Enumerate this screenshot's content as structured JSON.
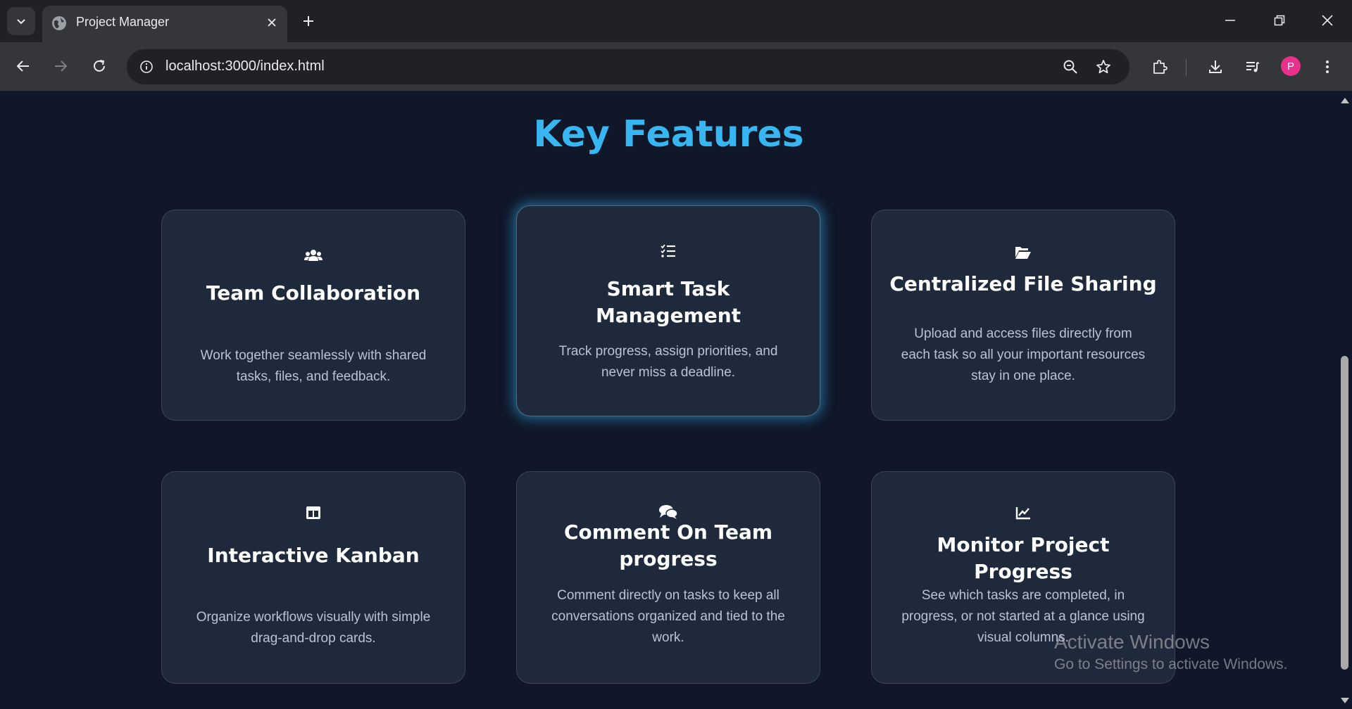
{
  "browser": {
    "tab_title": "Project Manager",
    "url": "localhost:3000/index.html",
    "profile_initial": "P",
    "icons": [
      "tab-list-icon",
      "globe-icon",
      "close-icon",
      "plus-icon",
      "minimize-icon",
      "restore-icon",
      "window-close-icon",
      "back-icon",
      "forward-icon",
      "reload-icon",
      "info-icon",
      "zoom-icon",
      "star-icon",
      "extensions-icon",
      "download-icon",
      "media-icon",
      "menu-icon"
    ]
  },
  "page": {
    "heading": "Key Features",
    "accent_color": "#38b6f2",
    "features": [
      {
        "icon": "users-icon",
        "title": "Team Collaboration",
        "description": "Work together seamlessly with shared tasks, files, and feedback."
      },
      {
        "icon": "task-list-icon",
        "title": "Smart Task Management",
        "description": "Track progress, assign priorities, and never miss a deadline."
      },
      {
        "icon": "folder-open-icon",
        "title": "Centralized File Sharing",
        "description": "Upload and access files directly from each task so all your important resources stay in one place."
      },
      {
        "icon": "kanban-icon",
        "title": "Interactive Kanban",
        "description": "Organize workflows visually with simple drag-and-drop cards."
      },
      {
        "icon": "comments-icon",
        "title": "Comment On Team progress",
        "description": "Comment directly on tasks to keep all conversations organized and tied to the work."
      },
      {
        "icon": "chart-line-icon",
        "title": "Monitor Project Progress",
        "description": "See which tasks are completed, in progress, or not started at a glance using visual columns."
      }
    ]
  },
  "watermark": {
    "line1": "Activate Windows",
    "line2": "Go to Settings to activate Windows."
  }
}
